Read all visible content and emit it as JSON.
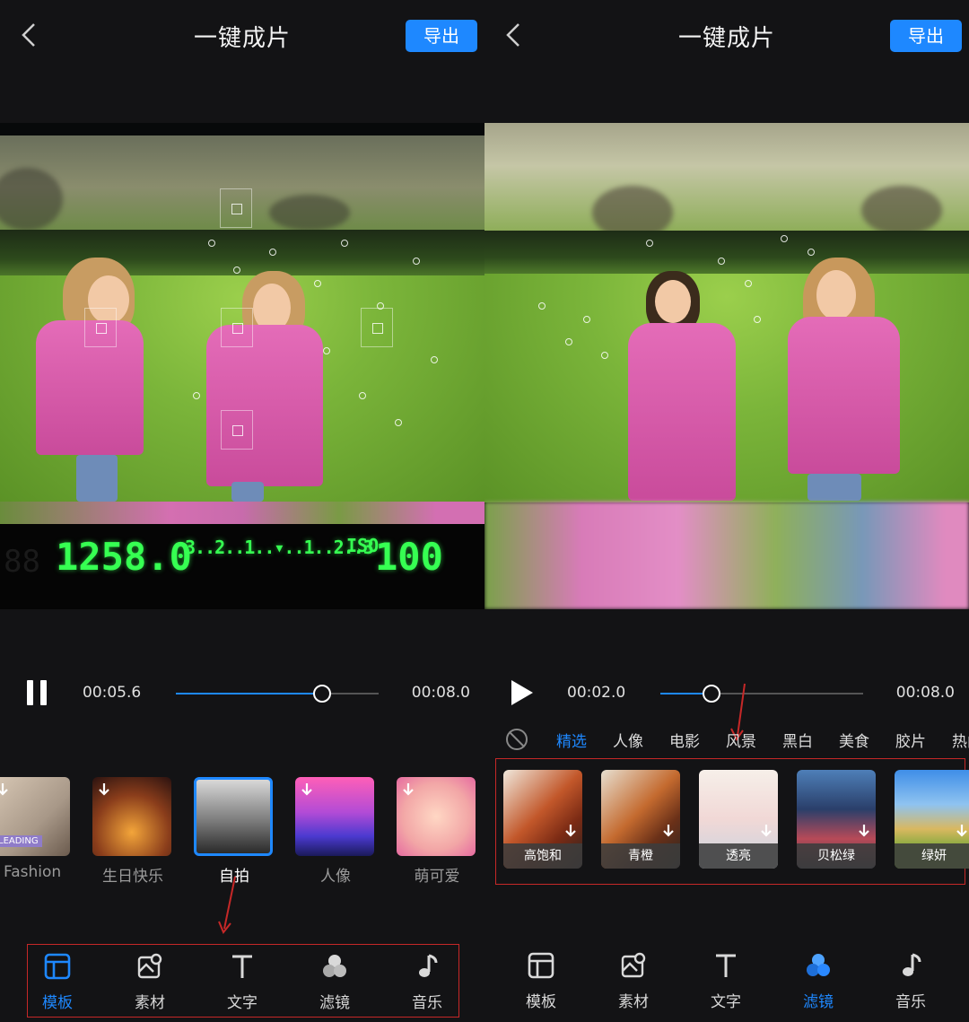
{
  "left": {
    "header": {
      "title": "一键成片",
      "export_label": "导出"
    },
    "hud": {
      "shutter": "125",
      "aperture": "8.0",
      "scale": "3..2..1..▾..1..2..3",
      "iso_label": "ISO",
      "iso": "100"
    },
    "player": {
      "state": "paused",
      "current_time": "00:05.6",
      "total_time": "00:08.0",
      "progress": 0.72
    },
    "templates": [
      {
        "label": "Fashion",
        "badge": "LEADING",
        "selected": false
      },
      {
        "label": "生日快乐",
        "selected": false
      },
      {
        "label": "自拍",
        "selected": true
      },
      {
        "label": "人像",
        "selected": false
      },
      {
        "label": "萌可爱",
        "selected": false
      }
    ],
    "toolbar": [
      {
        "label": "模板",
        "icon": "template-icon",
        "selected": true
      },
      {
        "label": "素材",
        "icon": "media-icon",
        "selected": false
      },
      {
        "label": "文字",
        "icon": "text-icon",
        "selected": false
      },
      {
        "label": "滤镜",
        "icon": "filter-icon",
        "selected": false
      },
      {
        "label": "音乐",
        "icon": "music-icon",
        "selected": false
      }
    ]
  },
  "right": {
    "header": {
      "title": "一键成片",
      "export_label": "导出"
    },
    "player": {
      "state": "playing",
      "current_time": "00:02.0",
      "total_time": "00:08.0",
      "progress": 0.25
    },
    "filter_categories": [
      {
        "label": "精选",
        "selected": true
      },
      {
        "label": "人像",
        "selected": false
      },
      {
        "label": "电影",
        "selected": false
      },
      {
        "label": "风景",
        "selected": false
      },
      {
        "label": "黑白",
        "selected": false
      },
      {
        "label": "美食",
        "selected": false
      },
      {
        "label": "胶片",
        "selected": false
      },
      {
        "label": "热门",
        "selected": false
      }
    ],
    "filters": [
      {
        "label": "高饱和"
      },
      {
        "label": "青橙"
      },
      {
        "label": "透亮"
      },
      {
        "label": "贝松绿"
      },
      {
        "label": "绿妍"
      }
    ],
    "toolbar": [
      {
        "label": "模板",
        "icon": "template-icon",
        "selected": false
      },
      {
        "label": "素材",
        "icon": "media-icon",
        "selected": false
      },
      {
        "label": "文字",
        "icon": "text-icon",
        "selected": false
      },
      {
        "label": "滤镜",
        "icon": "filter-icon",
        "selected": true
      },
      {
        "label": "音乐",
        "icon": "music-icon",
        "selected": false
      }
    ]
  },
  "colors": {
    "accent": "#1e88ff",
    "annotation": "#c62828",
    "background": "#131315"
  }
}
